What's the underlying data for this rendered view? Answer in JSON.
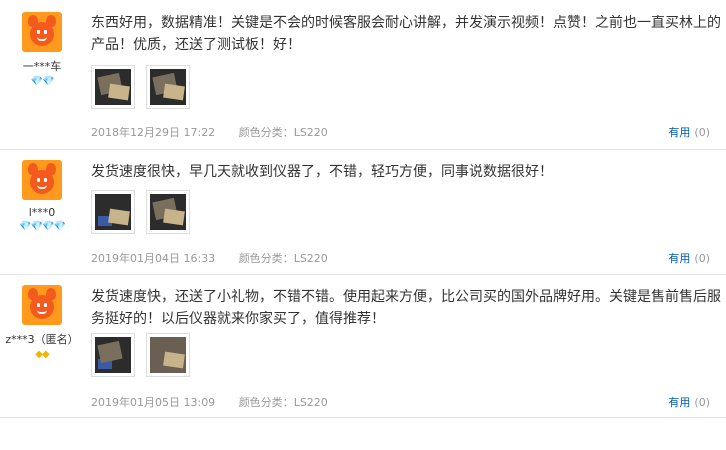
{
  "reviews": [
    {
      "nickname": "一***车",
      "level_icons": "💎💎",
      "text": "东西好用，数据精准！关键是不会的时候客服会耐心讲解，并发演示视频！点赞！之前也一直买林上的产品！优质，还送了测试板！好！",
      "date": "2018年12月29日 17:22",
      "color_label": "颜色分类：",
      "color_value": "LS220",
      "useful_label": "有用",
      "useful_count": "(0)"
    },
    {
      "nickname": "l***0",
      "level_icons": "💎💎💎💎",
      "text": "发货速度很快，早几天就收到仪器了，不错，轻巧方便，同事说数据很好！",
      "date": "2019年01月04日 16:33",
      "color_label": "颜色分类：",
      "color_value": "LS220",
      "useful_label": "有用",
      "useful_count": "(0)"
    },
    {
      "nickname": "z***3（匿名）",
      "level_icons": "◆◆",
      "text": "发货速度快，还送了小礼物，不错不错。使用起来方便，比公司买的国外品牌好用。关键是售前售后服务挺好的！以后仪器就来你家买了，值得推荐！",
      "date": "2019年01月05日 13:09",
      "color_label": "颜色分类：",
      "color_value": "LS220",
      "useful_label": "有用",
      "useful_count": "(0)"
    }
  ]
}
